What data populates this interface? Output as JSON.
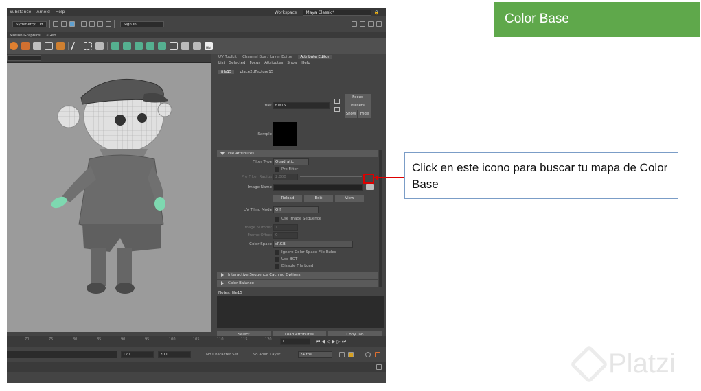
{
  "slide": {
    "title": "Color Base",
    "callout": "Click en este icono para buscar tu mapa de Color Base",
    "watermark": "Platzi"
  },
  "maya": {
    "menubar": [
      "Substance",
      "Arnold",
      "Help"
    ],
    "symmetry": "Symmetry: Off",
    "signin": "Sign In",
    "workspace_label": "Workspace :",
    "workspace_value": "Maya Classic*",
    "shelf_tabs": [
      "Motion Graphics",
      "XGen"
    ],
    "hist_label": "Hist",
    "panel_tabs": [
      "UV Toolkit",
      "Channel Box / Layer Editor",
      "Attribute Editor"
    ],
    "panel_menu": [
      "List",
      "Selected",
      "Focus",
      "Attributes",
      "Show",
      "Help"
    ],
    "node_tabs": [
      "file15",
      "place2dTexture15"
    ],
    "file_label": "file:",
    "file_value": "file15",
    "focus_btn": "Focus",
    "presets_btn": "Presets",
    "show_btn": "Show",
    "hide_btn": "Hide",
    "sample_label": "Sample",
    "section_file": "File Attributes",
    "filter_type_label": "Filter Type",
    "filter_type_value": "Quadratic",
    "pre_filter_label": "Pre Filter",
    "pre_filter_radius_label": "Pre Filter Radius",
    "pre_filter_radius_value": "2.000",
    "image_name_label": "Image Name",
    "reload_btn": "Reload",
    "edit_btn": "Edit",
    "view_btn": "View",
    "uv_tiling_label": "UV Tiling Mode",
    "uv_tiling_value": "Off",
    "use_image_seq": "Use Image Sequence",
    "image_number_label": "Image Number",
    "image_number_value": "1",
    "frame_offset_label": "Frame Offset",
    "frame_offset_value": "0",
    "color_space_label": "Color Space",
    "color_space_value": "sRGB",
    "ignore_cs": "Ignore Color Space File Rules",
    "use_bot": "Use BOT",
    "disable_load": "Disable File Load",
    "section_interactive": "Interactive Sequence Caching Options",
    "section_color_balance": "Color Balance",
    "notes_label": "Notes: file15",
    "select_btn": "Select",
    "load_attr_btn": "Load Attributes",
    "copy_tab_btn": "Copy Tab",
    "timeline_ticks": [
      "70",
      "75",
      "80",
      "85",
      "90",
      "95",
      "100",
      "105",
      "110",
      "115",
      "120"
    ],
    "current_frame": "1",
    "range_start": "120",
    "range_end": "200",
    "char_set": "No Character Set",
    "anim_layer": "No Anim Layer",
    "fps": "24 fps"
  }
}
